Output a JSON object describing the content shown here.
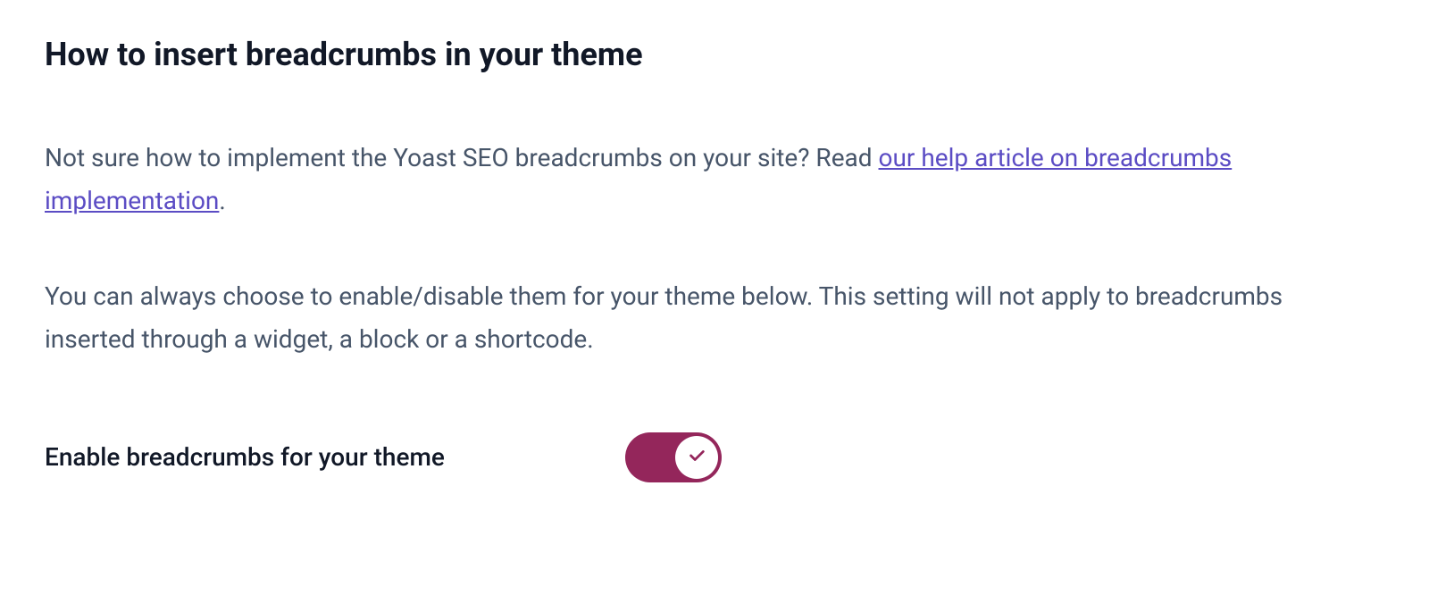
{
  "section": {
    "heading": "How to insert breadcrumbs in your theme",
    "paragraph1_before": "Not sure how to implement the Yoast SEO breadcrumbs on your site? Read ",
    "paragraph1_link": "our help article on breadcrumbs implementation",
    "paragraph1_after": ".",
    "paragraph2": "You can always choose to enable/disable them for your theme below. This setting will not apply to breadcrumbs inserted through a widget, a block or a shortcode."
  },
  "setting": {
    "label": "Enable breadcrumbs for your theme",
    "enabled": true
  },
  "colors": {
    "accent": "#94265b",
    "link": "#5b4cc4",
    "text_primary": "#111827",
    "text_secondary": "#475569"
  }
}
